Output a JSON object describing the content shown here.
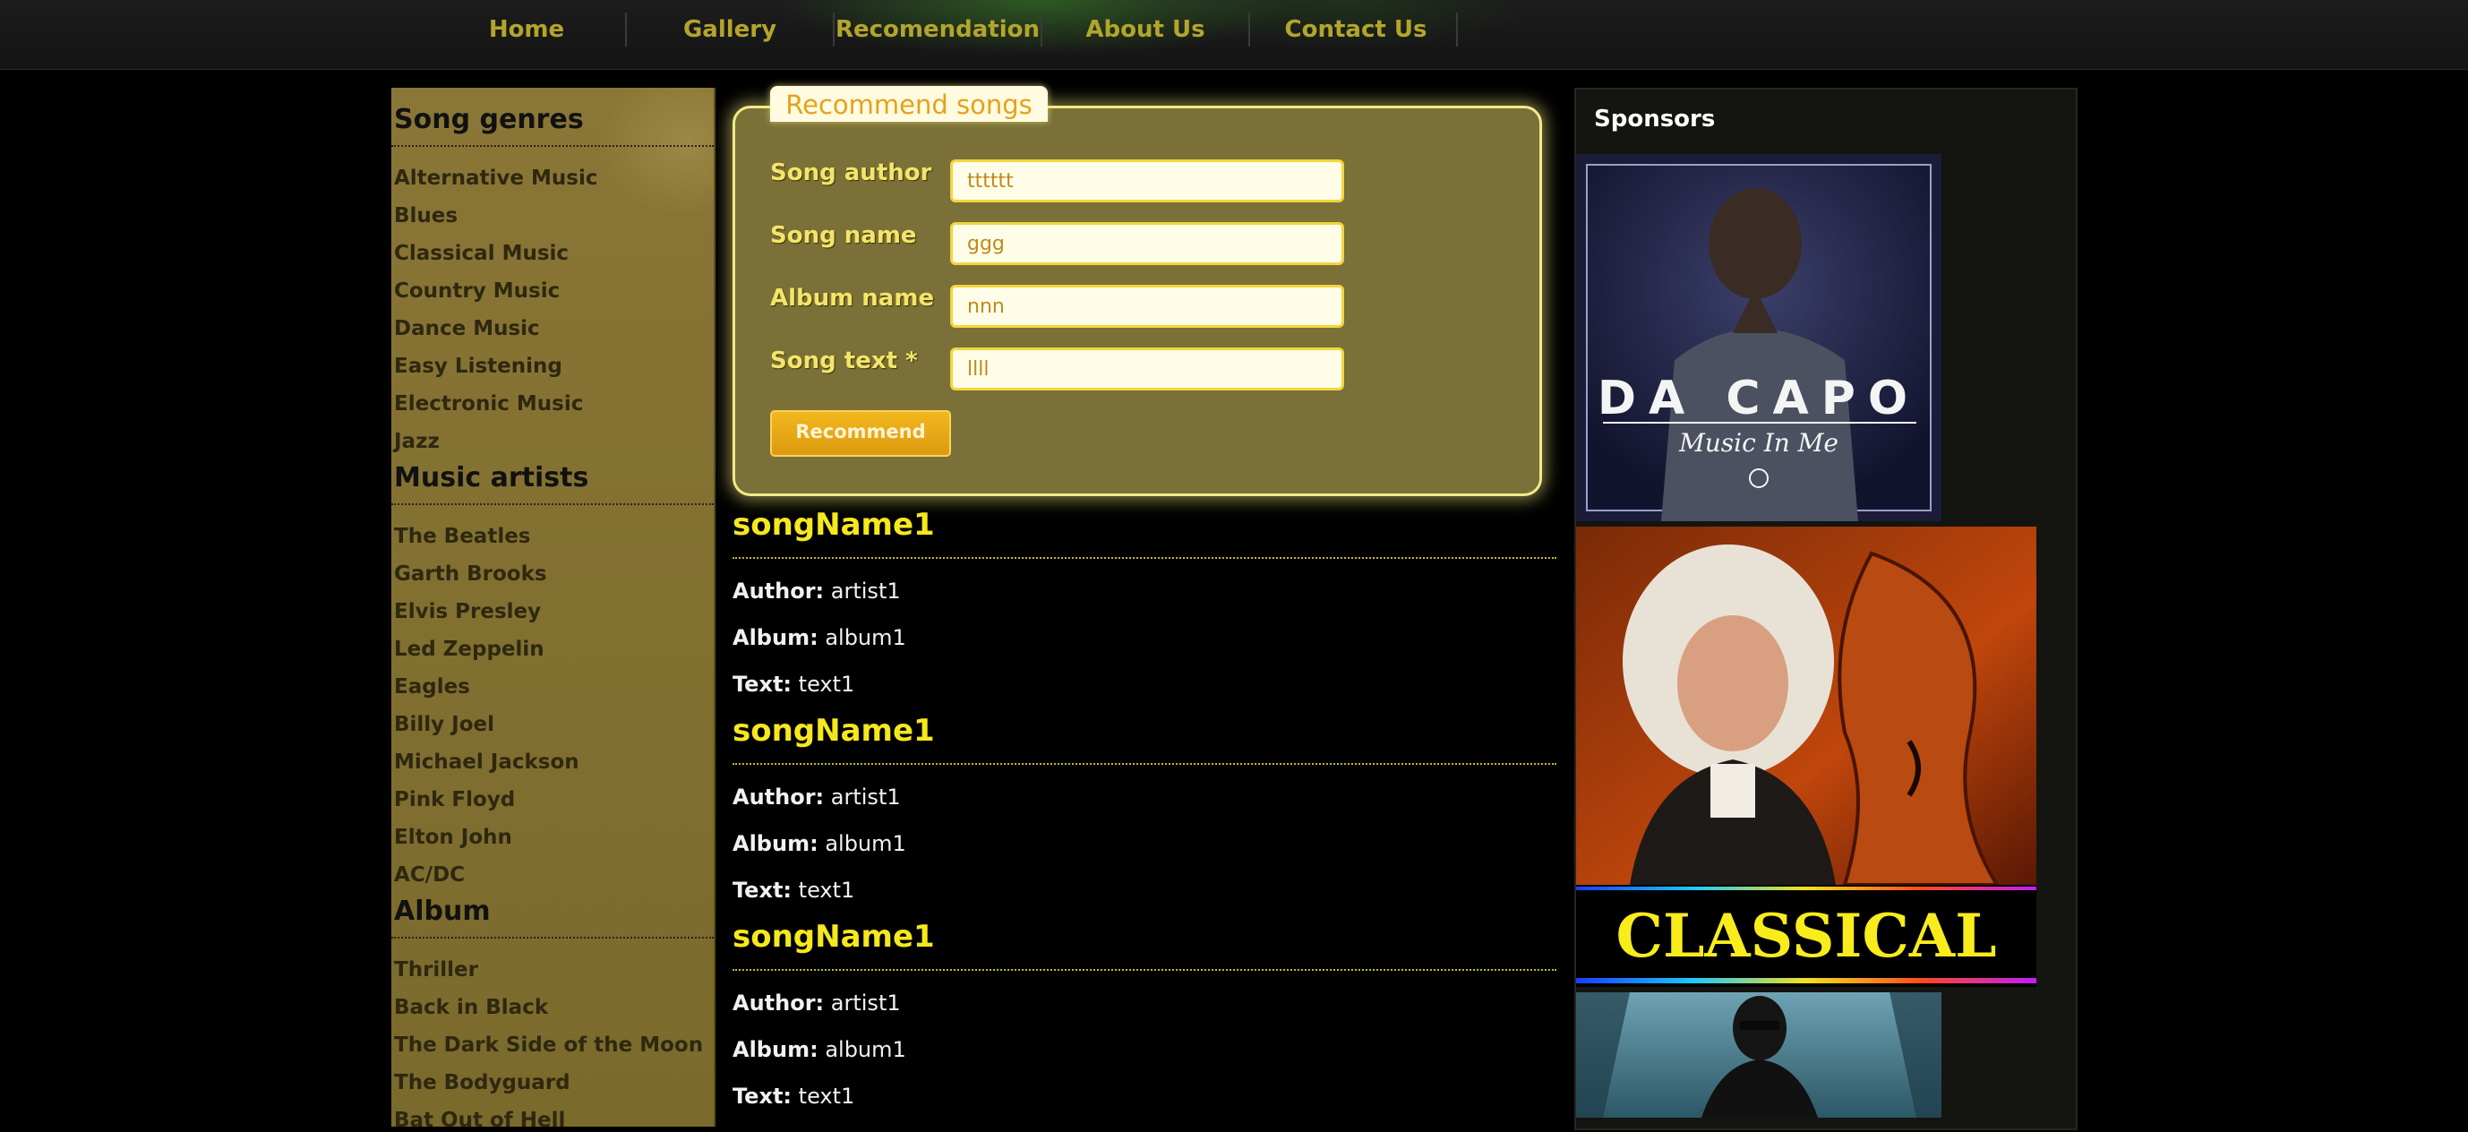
{
  "nav": {
    "items": [
      "Home",
      "Gallery",
      "Recomendation",
      "About Us",
      "Contact Us"
    ]
  },
  "sidebar": {
    "genres_heading": "Song genres",
    "genres": [
      "Alternative Music",
      "Blues",
      "Classical Music",
      "Country Music",
      "Dance Music",
      "Easy Listening",
      "Electronic Music",
      "Jazz"
    ],
    "artists_heading": "Music artists",
    "artists": [
      "The Beatles",
      "Garth Brooks",
      "Elvis Presley",
      "Led Zeppelin",
      "Eagles",
      "Billy Joel",
      "Michael Jackson",
      "Pink Floyd",
      "Elton John",
      "AC/DC"
    ],
    "album_heading": "Album",
    "albums": [
      "Thriller",
      "Back in Black",
      "The Dark Side of the Moon",
      "The Bodyguard",
      "Bat Out of Hell"
    ]
  },
  "form": {
    "legend": "Recommend songs",
    "fields": [
      {
        "label": "Song author",
        "value": "tttttt"
      },
      {
        "label": "Song name",
        "value": "ggg"
      },
      {
        "label": "Album name",
        "value": "nnn"
      },
      {
        "label": "Song text *",
        "value": "llll"
      }
    ],
    "submit_label": "Recommend"
  },
  "songs": [
    {
      "name": "songName1",
      "author_label": "Author:",
      "author": "artist1",
      "album_label": "Album:",
      "album": "album1",
      "text_label": "Text:",
      "text": "text1"
    },
    {
      "name": "songName1",
      "author_label": "Author:",
      "author": "artist1",
      "album_label": "Album:",
      "album": "album1",
      "text_label": "Text:",
      "text": "text1"
    },
    {
      "name": "songName1",
      "author_label": "Author:",
      "author": "artist1",
      "album_label": "Album:",
      "album": "album1",
      "text_label": "Text:",
      "text": "text1"
    }
  ],
  "sponsors": {
    "title": "Sponsors",
    "ads": [
      {
        "line1": "DA CAPO",
        "line2": "Music In Me"
      },
      {
        "line1": "CLASSICAL"
      }
    ]
  },
  "colors": {
    "nav_text": "#b3a52c",
    "accent_yellow": "#f5e81c",
    "button": "#f2b71d"
  }
}
